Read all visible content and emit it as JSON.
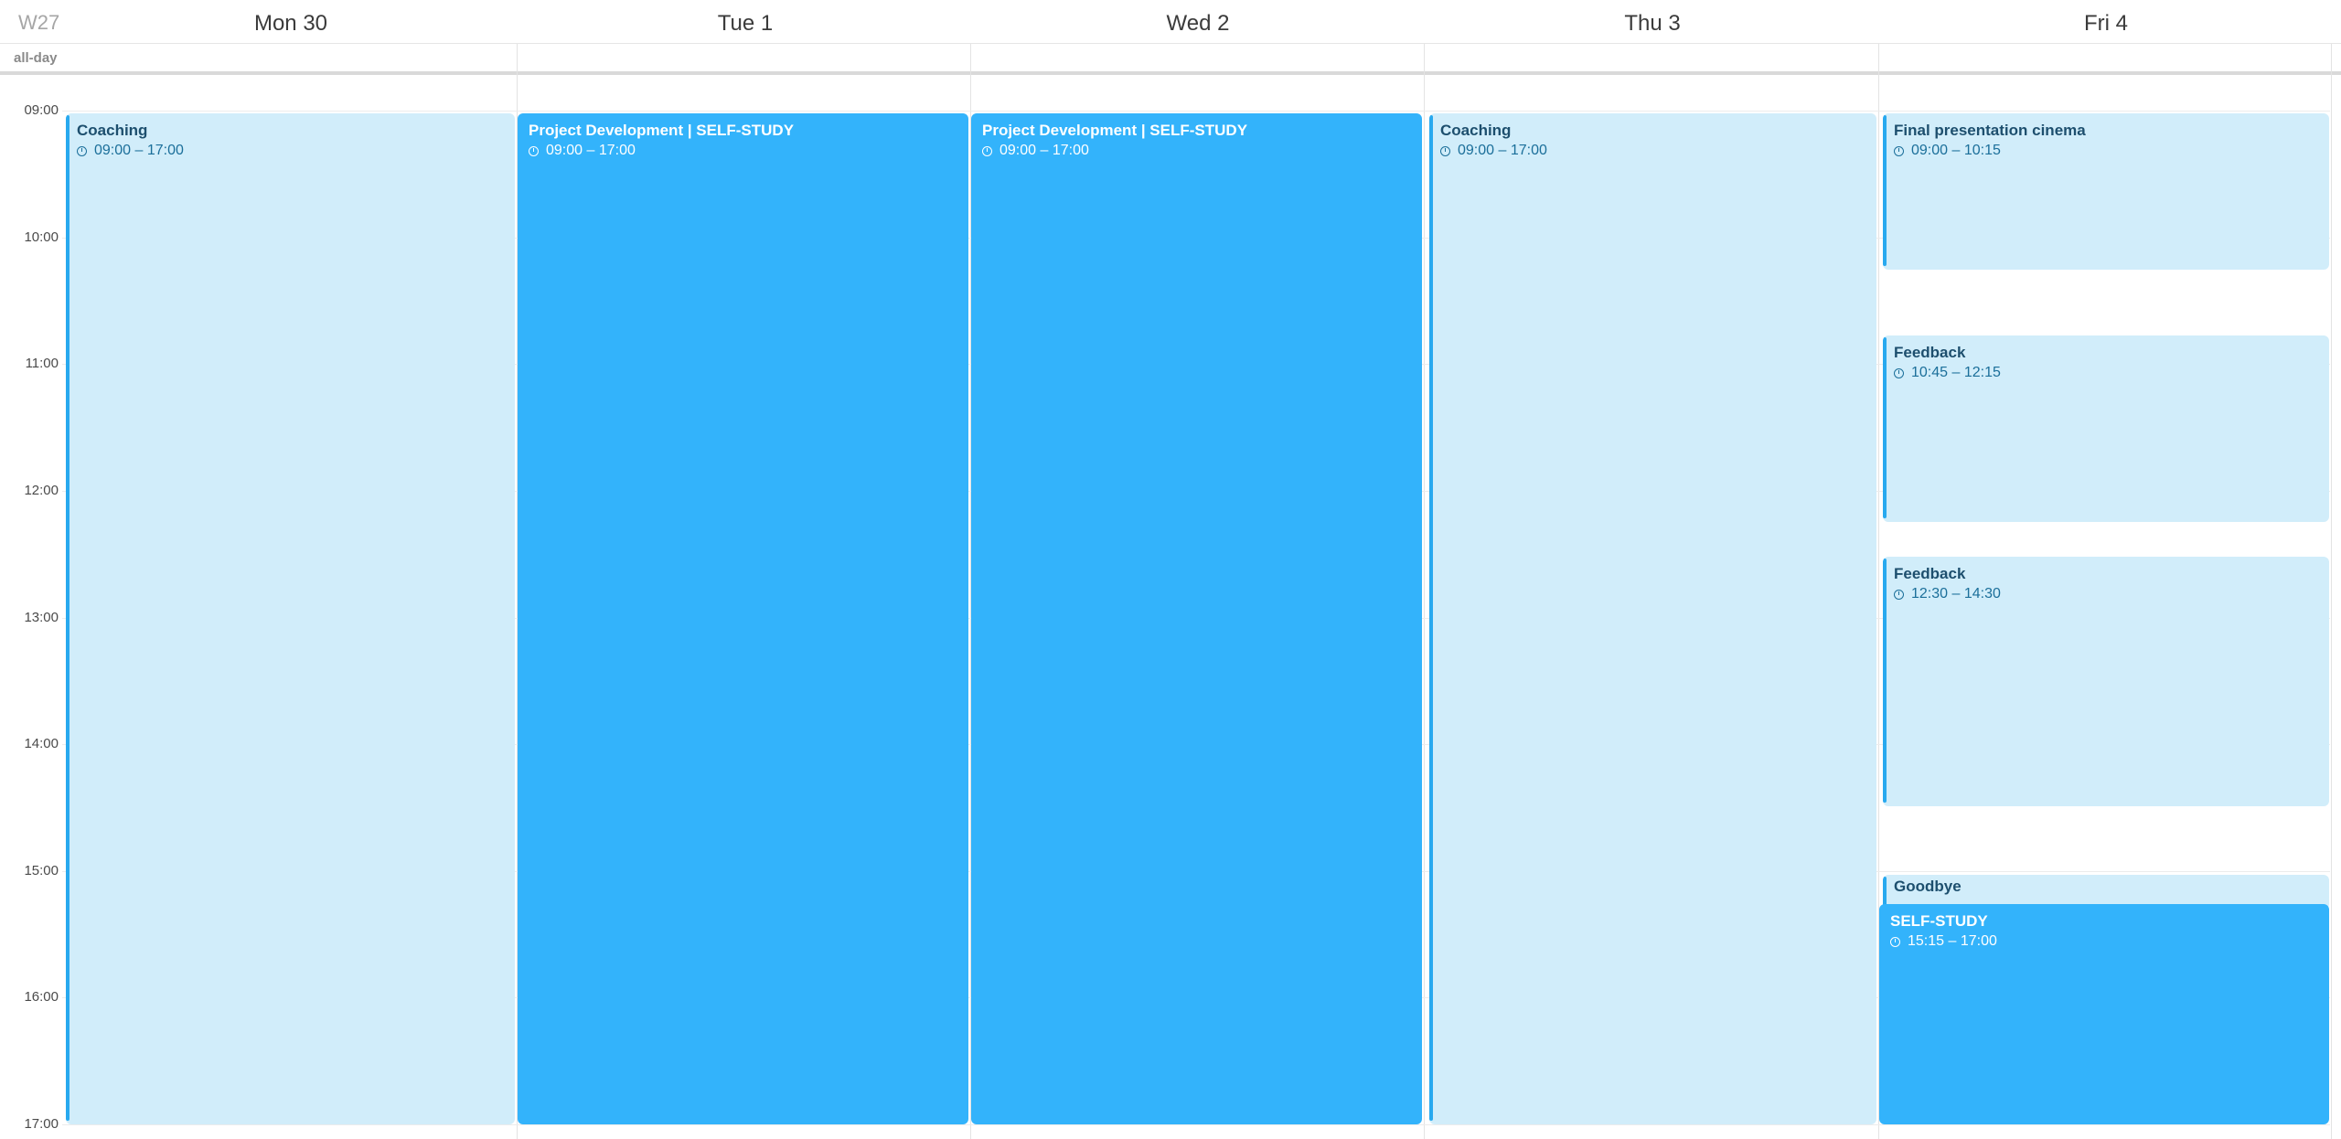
{
  "week_label": "W27",
  "allday_label": "all-day",
  "days": [
    "Mon 30",
    "Tue 1",
    "Wed 2",
    "Thu 3",
    "Fri 4"
  ],
  "hours": [
    "09:00",
    "10:00",
    "11:00",
    "12:00",
    "13:00",
    "14:00",
    "15:00",
    "16:00",
    "17:00"
  ],
  "colors": {
    "event_light": "#d1edfa",
    "event_dark": "#33b3fb",
    "accent_bar": "#28a9ef"
  },
  "events": {
    "mon_coaching": {
      "title": "Coaching",
      "time": "09:00 – 17:00"
    },
    "tue_project": {
      "title": "Project Development | SELF-STUDY",
      "time": "09:00 – 17:00"
    },
    "wed_project": {
      "title": "Project Development | SELF-STUDY",
      "time": "09:00 – 17:00"
    },
    "thu_coaching": {
      "title": "Coaching",
      "time": "09:00 – 17:00"
    },
    "fri_final": {
      "title": "Final presentation cinema",
      "time": "09:00 – 10:15"
    },
    "fri_feedback1": {
      "title": "Feedback",
      "time": "10:45 – 12:15"
    },
    "fri_feedback2": {
      "title": "Feedback",
      "time": "12:30 – 14:30"
    },
    "fri_goodbye": {
      "title": "Goodbye"
    },
    "fri_selfstudy": {
      "title": "SELF-STUDY",
      "time": "15:15 – 17:00"
    }
  }
}
